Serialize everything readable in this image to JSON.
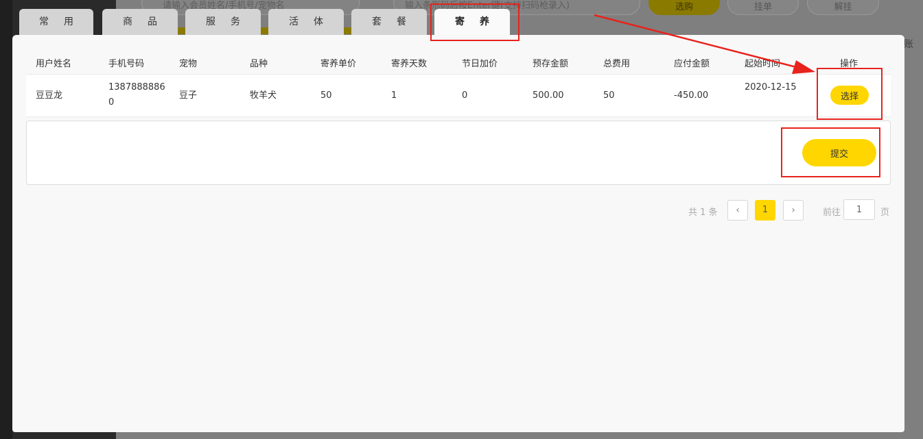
{
  "background": {
    "member_search_placeholder": "请输入会员姓名/手机号/宠物名",
    "barcode_placeholder": "输入条形码后按Enter键(支持扫码枪录入)",
    "select_btn": "选购",
    "hang_btn": "挂单",
    "unhang_btn": "解挂",
    "side_text": "账"
  },
  "tabs": [
    {
      "label": "常用"
    },
    {
      "label": "商品"
    },
    {
      "label": "服务"
    },
    {
      "label": "活体"
    },
    {
      "label": "套餐"
    },
    {
      "label": "寄养",
      "active": true
    }
  ],
  "table": {
    "headers": [
      "用户姓名",
      "手机号码",
      "宠物",
      "品种",
      "寄养单价",
      "寄养天数",
      "节日加价",
      "预存金额",
      "总费用",
      "应付金额",
      "起始时间",
      "操作"
    ],
    "rows": [
      {
        "name": "豆豆龙",
        "phone": "13878888860",
        "pet": "豆子",
        "breed": "牧羊犬",
        "unit_price": "50",
        "days": "1",
        "holiday_extra": "0",
        "deposit": "500.00",
        "total": "50",
        "payable": "-450.00",
        "start": "2020-12-15",
        "action": "选择"
      }
    ]
  },
  "submit_label": "提交",
  "pagination": {
    "total_text": "共 1 条",
    "current_page": "1",
    "goto_label": "前往",
    "goto_value": "1",
    "page_label": "页"
  },
  "colors": {
    "accent": "#ffd600",
    "annotation": "#e8221c"
  }
}
